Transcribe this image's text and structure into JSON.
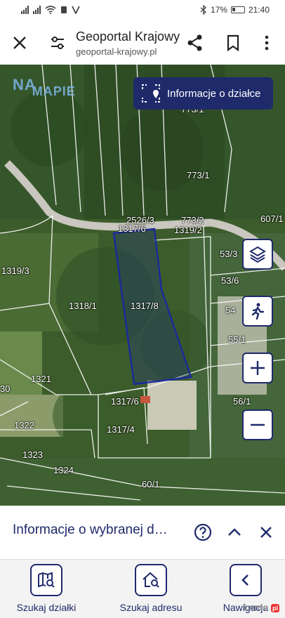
{
  "status_bar": {
    "battery_percent": "17%",
    "time": "21:40"
  },
  "toolbar": {
    "title": "Geoportal Krajowy",
    "url": "geoportal-krajowy.pl"
  },
  "map": {
    "logo": {
      "part1": "NA",
      "part2": "MAPIE"
    },
    "info_button_label": "Informacje o działce",
    "parcels": [
      {
        "label": "773/1"
      },
      {
        "label": "773/1"
      },
      {
        "label": "607/1"
      },
      {
        "label": "2526/3"
      },
      {
        "label": "773/2"
      },
      {
        "label": "1317/6"
      },
      {
        "label": "1319/2"
      },
      {
        "label": "53/3"
      },
      {
        "label": "1319/3"
      },
      {
        "label": "53/6"
      },
      {
        "label": "1318/1"
      },
      {
        "label": "1317/8"
      },
      {
        "label": "54"
      },
      {
        "label": "55/1"
      },
      {
        "label": "1321"
      },
      {
        "label": "30"
      },
      {
        "label": "1317/6"
      },
      {
        "label": "56/1"
      },
      {
        "label": "1322"
      },
      {
        "label": "1317/4"
      },
      {
        "label": "1323"
      },
      {
        "label": "1324"
      },
      {
        "label": "60/1"
      }
    ]
  },
  "sheet": {
    "title": "Informacje o wybranej działce"
  },
  "bottom_nav": {
    "items": [
      {
        "label": "Szukaj działki"
      },
      {
        "label": "Szukaj adresu"
      },
      {
        "label": "Nawigacja"
      }
    ]
  },
  "watermark": {
    "text": "Lento",
    "badge": "pl"
  }
}
